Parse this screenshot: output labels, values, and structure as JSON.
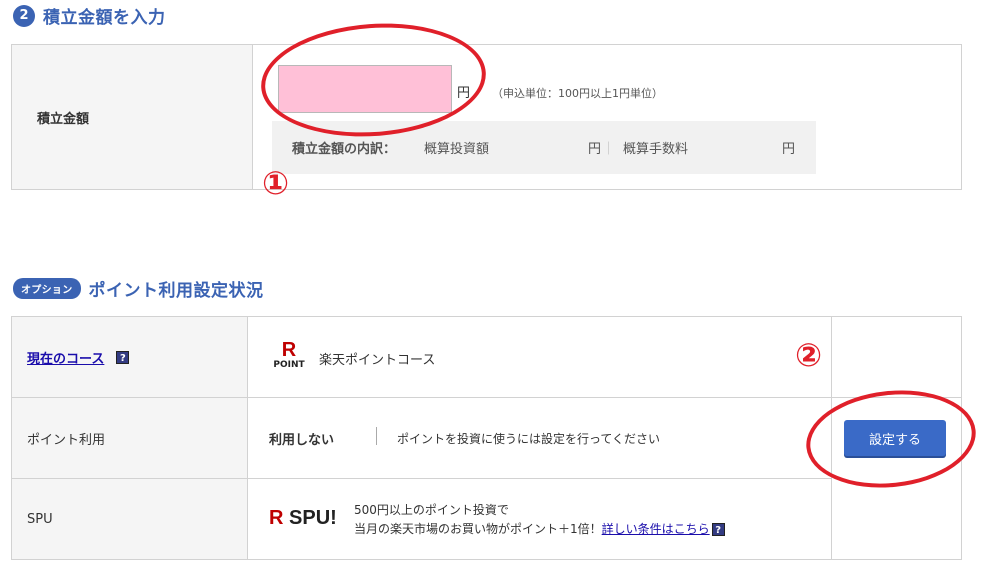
{
  "section1": {
    "step_number": "2",
    "title": "積立金額を入力"
  },
  "amount": {
    "label": "積立金額",
    "value": "",
    "unit": "円",
    "note": "（申込単位：100円以上1円単位）",
    "breakdown_label": "積立金額の内訳：",
    "investment_label": "概算投資額",
    "investment_unit": "円",
    "separator": "｜",
    "fee_label": "概算手数料",
    "fee_unit": "円"
  },
  "annotations": {
    "marker1": "①",
    "marker2": "②",
    "color": "#e0202a"
  },
  "section2": {
    "badge": "オプション",
    "title": "ポイント利用設定状況"
  },
  "course": {
    "label": "現在のコース",
    "help": "?",
    "logo_letter": "R",
    "logo_text": "POINT",
    "value": "楽天ポイントコース"
  },
  "point_use": {
    "label": "ポイント利用",
    "status": "利用しない",
    "description": "ポイントを投資に使うには設定を行ってください",
    "button_label": "設定する"
  },
  "spu": {
    "label": "SPU",
    "logo_r": "R",
    "logo_text": "SPU!",
    "line1": "500円以上のポイント投資で",
    "line2": "当月の楽天市場のお買い物がポイント＋1倍！",
    "link": "詳しい条件はこちら",
    "help": "?"
  },
  "colors": {
    "accent": "#3b63b3",
    "input_bg": "#ffc0d7",
    "button": "#3a6ac7",
    "brand_red": "#bf0000"
  }
}
